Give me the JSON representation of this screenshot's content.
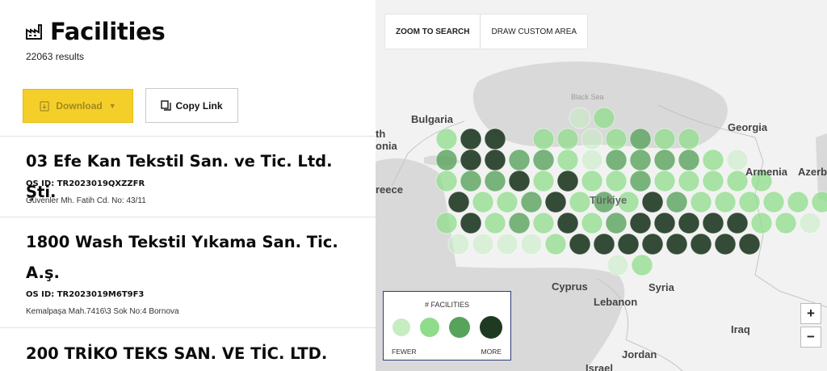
{
  "header": {
    "title": "Facilities",
    "icon": "factory-icon",
    "results": "22063 results"
  },
  "toolbar": {
    "download_label": "Download",
    "copy_label": "Copy Link"
  },
  "facilities": [
    {
      "name": "03 Efe Kan Tekstil San. ve Tic. Ltd. Şti.",
      "os_id": "OS ID: TR2023019QXZZFR",
      "address": "Güvenler Mh. Fatih Cd. No: 43/11"
    },
    {
      "name": "1800 Wash Tekstil Yıkama San. Tic. A.ş.",
      "os_id": "OS ID: TR2023019M6T9F3",
      "address": "Kemalpaşa Mah.7416\\3 Sok No:4 Bornova"
    },
    {
      "name": "200 TRİKO TEKS SAN. VE TİC. LTD."
    }
  ],
  "map": {
    "tabs": [
      "ZOOM TO SEARCH",
      "DRAW CUSTOM AREA"
    ],
    "labels": {
      "bulgaria": "Bulgaria",
      "black_sea": "Black Sea",
      "georgia": "Georgia",
      "armenia": "Armenia",
      "azer": "Azerb",
      "greece": "reece",
      "th": "th",
      "onia": "onia",
      "turkiye": "Türkiye",
      "cyprus": "Cyprus",
      "syria": "Syria",
      "lebanon": "Lebanon",
      "iraq": "Iraq",
      "jordan": "Jordan",
      "israel": "Israel"
    },
    "legend": {
      "title": "# FACILITIES",
      "fewer": "FEWER",
      "more": "MORE",
      "colors": [
        "#c6ecc2",
        "#8fdc8b",
        "#58a35b",
        "#1f3a22"
      ]
    },
    "zoom_in": "+",
    "zoom_out": "−"
  }
}
